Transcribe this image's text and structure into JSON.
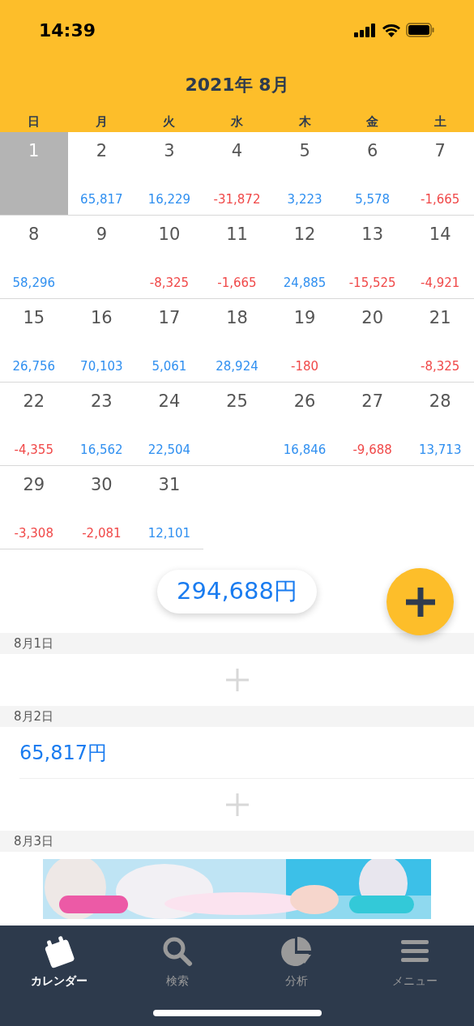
{
  "status_bar": {
    "time": "14:39"
  },
  "header": {
    "title": "2021年 8月"
  },
  "weekdays": [
    "日",
    "月",
    "火",
    "水",
    "木",
    "金",
    "土"
  ],
  "weeks": [
    [
      {
        "day": "1",
        "selected": true
      },
      {
        "day": "2",
        "amount": "65,817",
        "kind": "income",
        "selected": false
      },
      {
        "day": "3",
        "amount": "16,229",
        "kind": "income",
        "selected": false
      },
      {
        "day": "4",
        "amount": "-31,872",
        "kind": "expense",
        "selected": false
      },
      {
        "day": "5",
        "amount": "3,223",
        "kind": "income",
        "selected": false
      },
      {
        "day": "6",
        "amount": "5,578",
        "kind": "income",
        "selected": false
      },
      {
        "day": "7",
        "amount": "-1,665",
        "kind": "expense",
        "selected": false
      }
    ],
    [
      {
        "day": "8",
        "amount": "58,296",
        "kind": "income",
        "selected": false
      },
      {
        "day": "9",
        "selected": false
      },
      {
        "day": "10",
        "amount": "-8,325",
        "kind": "expense",
        "selected": false
      },
      {
        "day": "11",
        "amount": "-1,665",
        "kind": "expense",
        "selected": false
      },
      {
        "day": "12",
        "amount": "24,885",
        "kind": "income",
        "selected": false
      },
      {
        "day": "13",
        "amount": "-15,525",
        "kind": "expense",
        "selected": false
      },
      {
        "day": "14",
        "amount": "-4,921",
        "kind": "expense",
        "selected": false
      }
    ],
    [
      {
        "day": "15",
        "amount": "26,756",
        "kind": "income",
        "selected": false
      },
      {
        "day": "16",
        "amount": "70,103",
        "kind": "income",
        "selected": false
      },
      {
        "day": "17",
        "amount": "5,061",
        "kind": "income",
        "selected": false
      },
      {
        "day": "18",
        "amount": "28,924",
        "kind": "income",
        "selected": false
      },
      {
        "day": "19",
        "amount": "-180",
        "kind": "expense",
        "selected": false
      },
      {
        "day": "20",
        "selected": false
      },
      {
        "day": "21",
        "amount": "-8,325",
        "kind": "expense",
        "selected": false
      }
    ],
    [
      {
        "day": "22",
        "amount": "-4,355",
        "kind": "expense",
        "selected": false
      },
      {
        "day": "23",
        "amount": "16,562",
        "kind": "income",
        "selected": false
      },
      {
        "day": "24",
        "amount": "22,504",
        "kind": "income",
        "selected": false
      },
      {
        "day": "25",
        "selected": false
      },
      {
        "day": "26",
        "amount": "16,846",
        "kind": "income",
        "selected": false
      },
      {
        "day": "27",
        "amount": "-9,688",
        "kind": "expense",
        "selected": false
      },
      {
        "day": "28",
        "amount": "13,713",
        "kind": "income",
        "selected": false
      }
    ],
    [
      {
        "day": "29",
        "amount": "-3,308",
        "kind": "expense",
        "selected": false
      },
      {
        "day": "30",
        "amount": "-2,081",
        "kind": "expense",
        "selected": false
      },
      {
        "day": "31",
        "amount": "12,101",
        "kind": "income",
        "selected": false
      }
    ]
  ],
  "total": "294,688円",
  "days": [
    {
      "date": "8月1日",
      "kind": "list"
    },
    {
      "date": "8月2日",
      "kind": "list",
      "entries": [
        {
          "amount": "65,817円"
        }
      ]
    },
    {
      "date": "8月3日",
      "kind": "cut"
    }
  ],
  "ad": {
    "kind": "picture"
  },
  "tabs": [
    {
      "label": "カレンダー",
      "kind": "calendar",
      "selected": true
    },
    {
      "label": "検索",
      "kind": "search",
      "selected": false
    },
    {
      "label": "分析",
      "kind": "chart",
      "selected": false
    },
    {
      "label": "メニュー",
      "kind": "menu",
      "selected": false
    }
  ]
}
